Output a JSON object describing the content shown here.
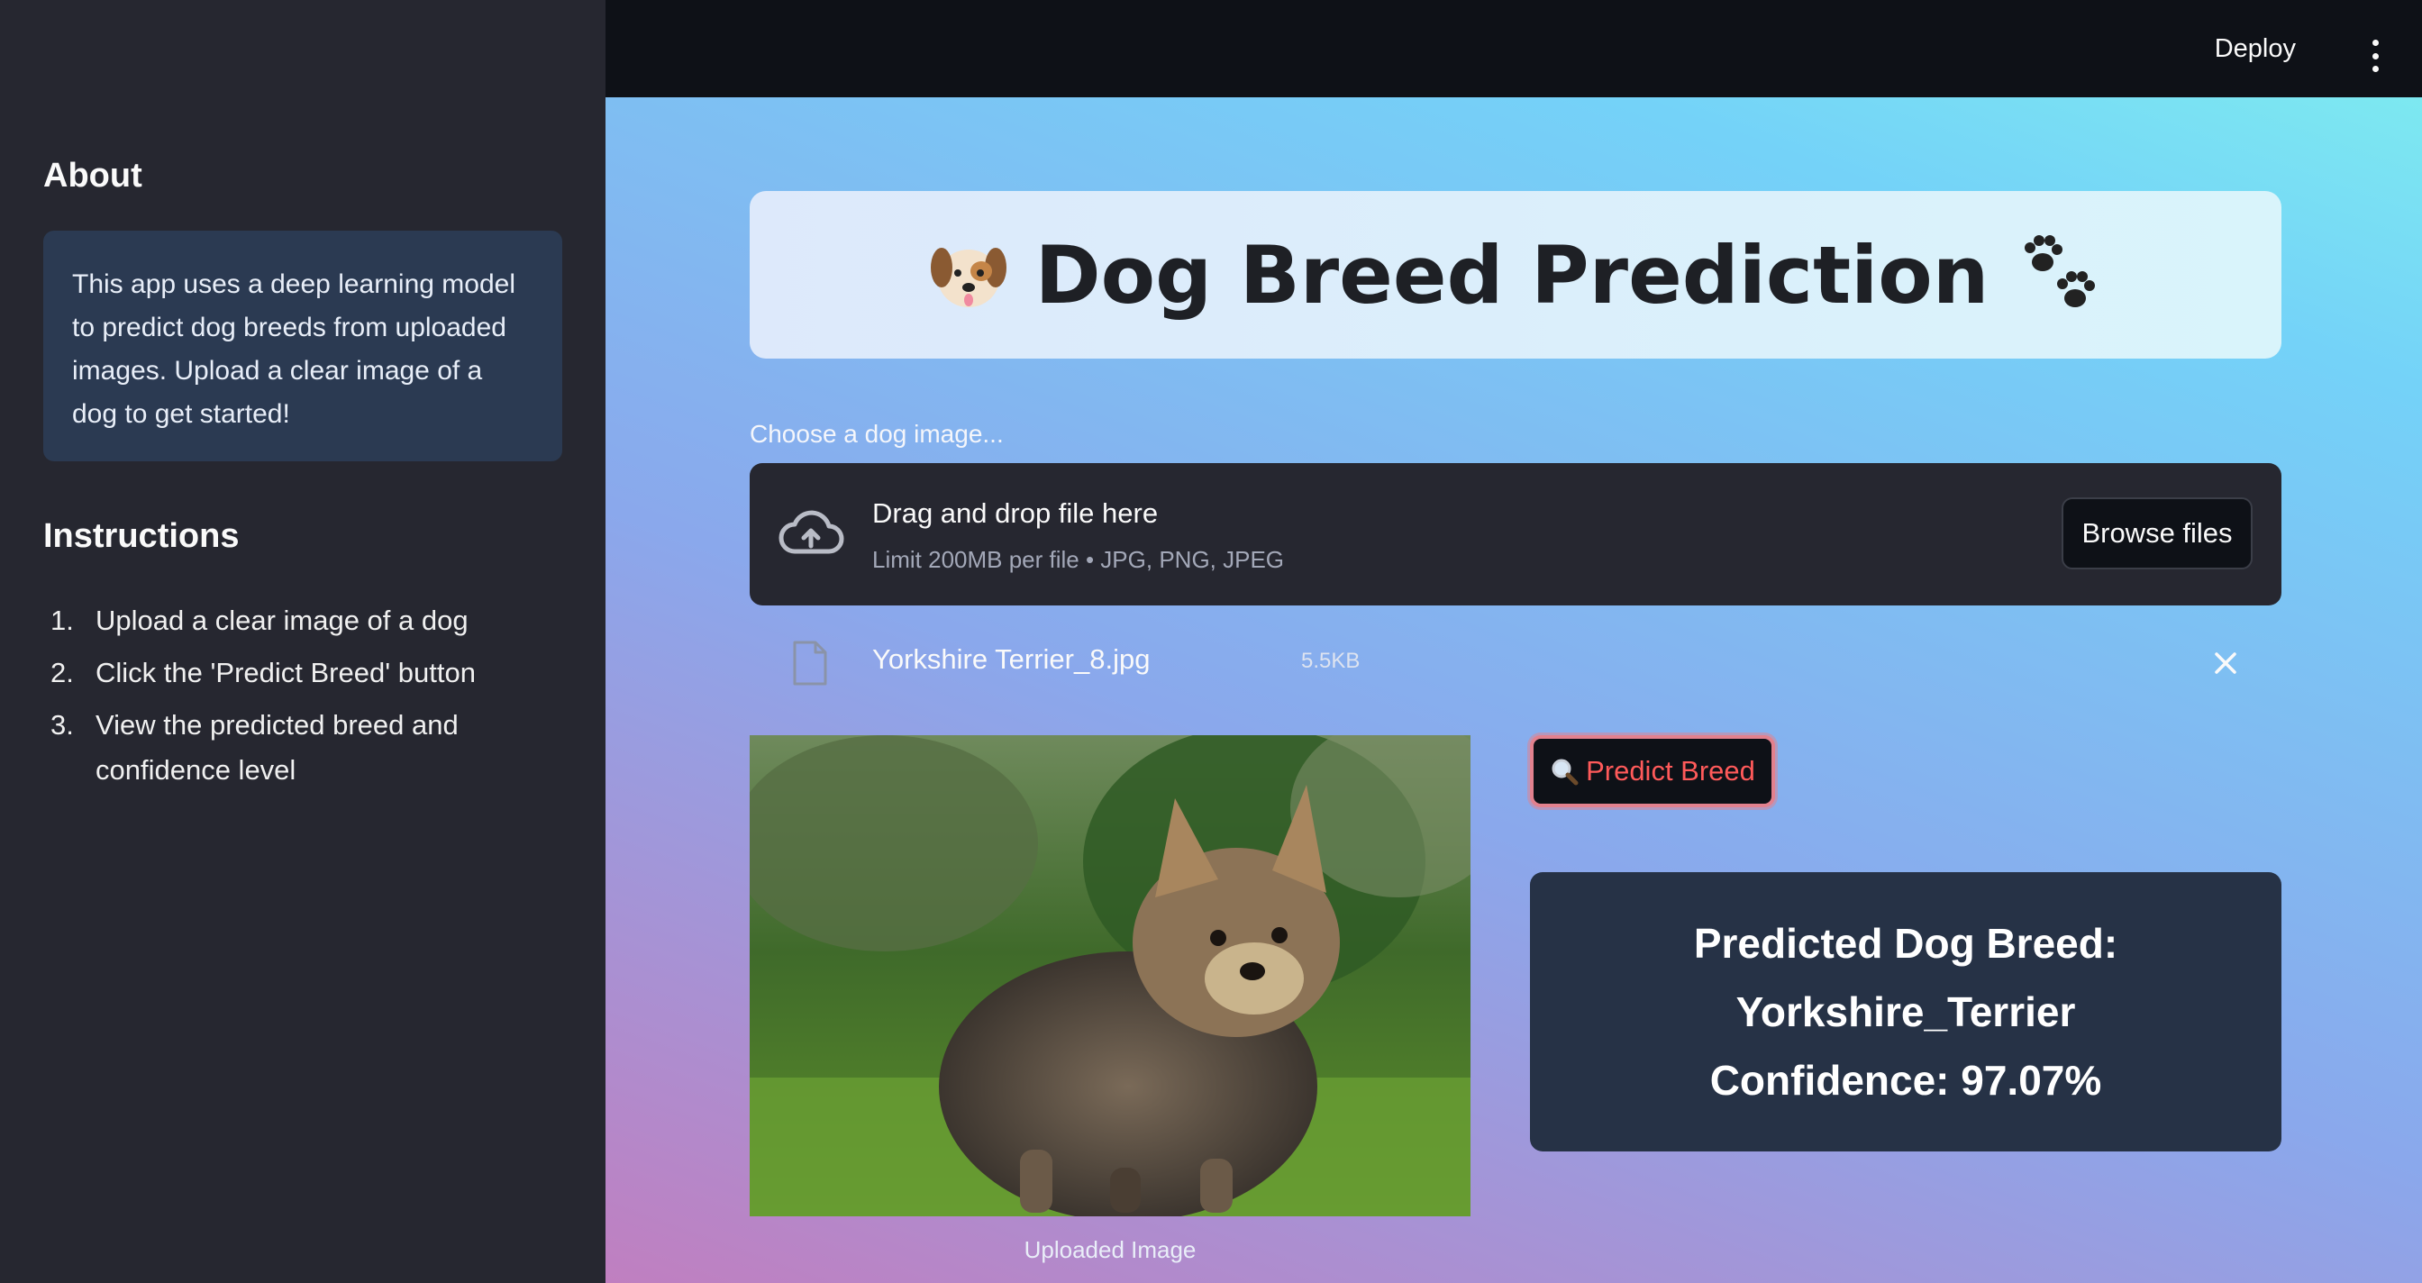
{
  "sidebar": {
    "about_title": "About",
    "about_text": "This app uses a deep learning model to predict dog breeds from uploaded images. Upload a clear image of a dog to get started!",
    "instructions_title": "Instructions",
    "instructions": [
      {
        "num": "1.",
        "text": "Upload a clear image of a dog"
      },
      {
        "num": "2.",
        "text": "Click the 'Predict Breed' button"
      },
      {
        "num": "3.",
        "text": "View the predicted breed and confidence level"
      }
    ]
  },
  "topbar": {
    "deploy_label": "Deploy",
    "menu_icon": "vertical-dots-icon"
  },
  "main": {
    "title": "Dog Breed Prediction",
    "title_icons": [
      "dog-face-icon",
      "paw-prints-icon"
    ],
    "uploader": {
      "label": "Choose a dog image...",
      "drag_text": "Drag and drop file here",
      "limit_text": "Limit 200MB per file • JPG, PNG, JPEG",
      "browse_label": "Browse files"
    },
    "file": {
      "name": "Yorkshire Terrier_8.jpg",
      "size": "5.5KB"
    },
    "image_caption": "Uploaded Image",
    "predict_label": "Predict Breed",
    "result": {
      "line1": "Predicted Dog Breed:",
      "line2": "Yorkshire_Terrier",
      "line3": "Confidence: 97.07%"
    }
  },
  "colors": {
    "sidebar_bg": "#262730",
    "topbar_bg": "#0e1117",
    "predict_text": "#ff5a5a",
    "result_bg": "#263246"
  }
}
